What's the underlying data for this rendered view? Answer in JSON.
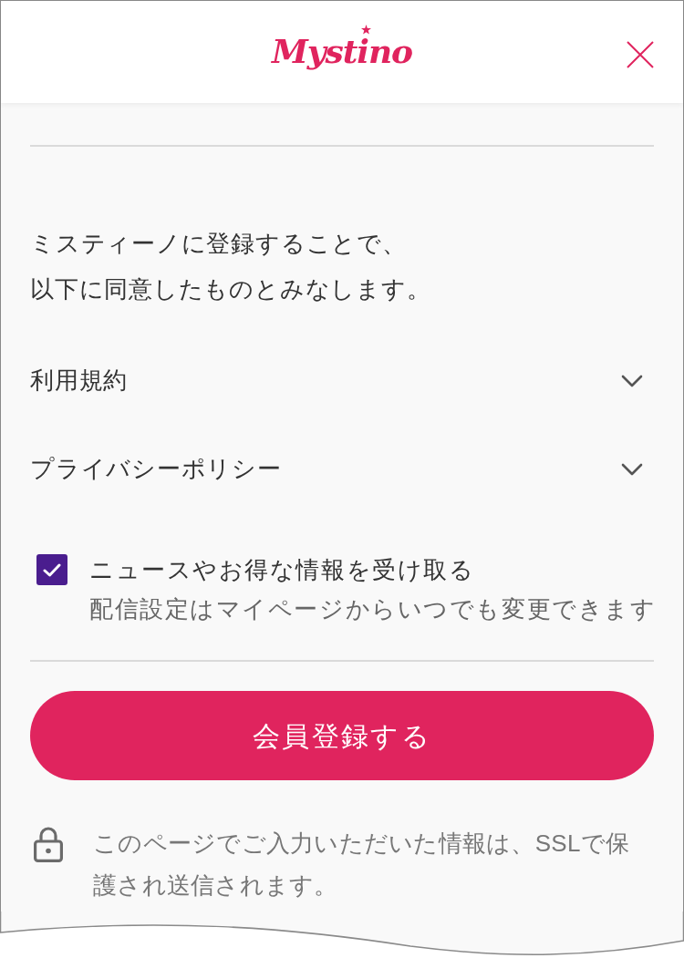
{
  "header": {
    "logo": "Mystino"
  },
  "intro": {
    "lines": [
      "ミスティーノに登録することで、",
      "以下に同意したものとみなします。"
    ]
  },
  "accordions": [
    {
      "label": "利用規約",
      "expanded": false
    },
    {
      "label": "プライバシーポリシー",
      "expanded": false
    }
  ],
  "newsletter": {
    "label": "ニュースやお得な情報を受け取る",
    "note": "配信設定はマイページからいつでも変更できます",
    "checked": true
  },
  "submit": {
    "label": "会員登録する"
  },
  "security_note": {
    "text": "このページでご入力いただいた情報は、SSLで保護され送信されます。"
  }
}
